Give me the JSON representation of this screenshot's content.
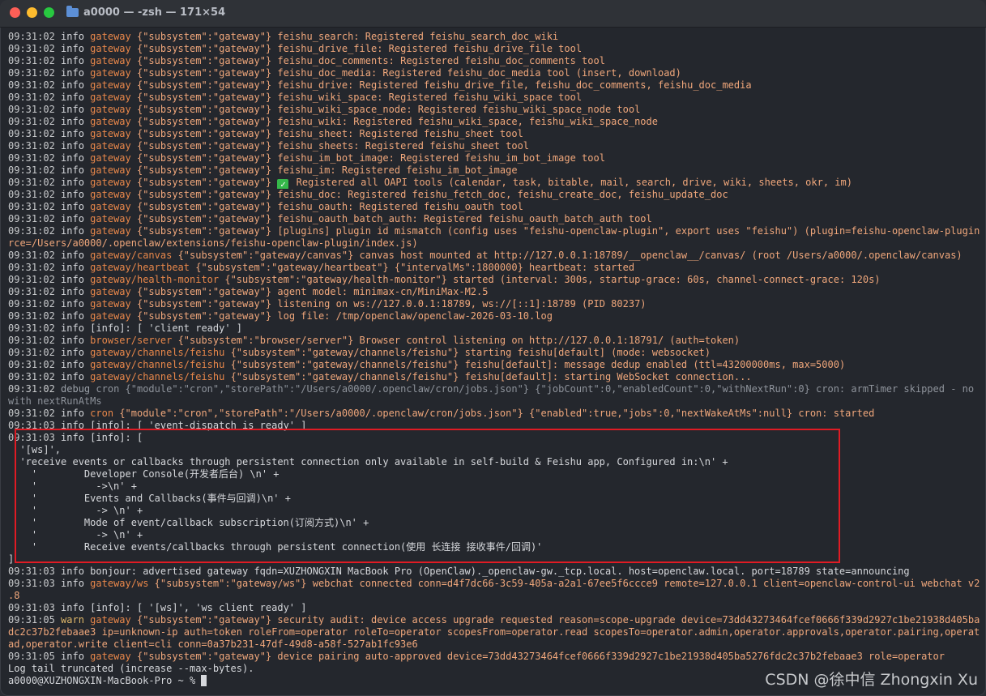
{
  "window": {
    "title": "a0000 — -zsh — 171×54"
  },
  "colors": {
    "background": "#24272d",
    "subsystem": "#e8874a",
    "message": "#f0a77b",
    "highlight": "#e01b24"
  },
  "log": [
    {
      "ts": "09:31:02",
      "level": "info",
      "sub": "gateway",
      "msg": "{\"subsystem\":\"gateway\"} feishu_search: Registered feishu_search_doc_wiki"
    },
    {
      "ts": "09:31:02",
      "level": "info",
      "sub": "gateway",
      "msg": "{\"subsystem\":\"gateway\"} feishu_drive_file: Registered feishu_drive_file tool"
    },
    {
      "ts": "09:31:02",
      "level": "info",
      "sub": "gateway",
      "msg": "{\"subsystem\":\"gateway\"} feishu_doc_comments: Registered feishu_doc_comments tool"
    },
    {
      "ts": "09:31:02",
      "level": "info",
      "sub": "gateway",
      "msg": "{\"subsystem\":\"gateway\"} feishu_doc_media: Registered feishu_doc_media tool (insert, download)"
    },
    {
      "ts": "09:31:02",
      "level": "info",
      "sub": "gateway",
      "msg": "{\"subsystem\":\"gateway\"} feishu_drive: Registered feishu_drive_file, feishu_doc_comments, feishu_doc_media"
    },
    {
      "ts": "09:31:02",
      "level": "info",
      "sub": "gateway",
      "msg": "{\"subsystem\":\"gateway\"} feishu_wiki_space: Registered feishu_wiki_space tool"
    },
    {
      "ts": "09:31:02",
      "level": "info",
      "sub": "gateway",
      "msg": "{\"subsystem\":\"gateway\"} feishu_wiki_space_node: Registered feishu_wiki_space_node tool"
    },
    {
      "ts": "09:31:02",
      "level": "info",
      "sub": "gateway",
      "msg": "{\"subsystem\":\"gateway\"} feishu_wiki: Registered feishu_wiki_space, feishu_wiki_space_node"
    },
    {
      "ts": "09:31:02",
      "level": "info",
      "sub": "gateway",
      "msg": "{\"subsystem\":\"gateway\"} feishu_sheet: Registered feishu_sheet tool"
    },
    {
      "ts": "09:31:02",
      "level": "info",
      "sub": "gateway",
      "msg": "{\"subsystem\":\"gateway\"} feishu_sheets: Registered feishu_sheet tool"
    },
    {
      "ts": "09:31:02",
      "level": "info",
      "sub": "gateway",
      "msg": "{\"subsystem\":\"gateway\"} feishu_im_bot_image: Registered feishu_im_bot_image tool"
    },
    {
      "ts": "09:31:02",
      "level": "info",
      "sub": "gateway",
      "msg": "{\"subsystem\":\"gateway\"} feishu_im: Registered feishu_im_bot_image"
    },
    {
      "ts": "09:31:02",
      "level": "info",
      "sub": "gateway",
      "check": "✓",
      "msg": "{\"subsystem\":\"gateway\"} ",
      "msg2": " Registered all OAPI tools (calendar, task, bitable, mail, search, drive, wiki, sheets, okr, im)"
    },
    {
      "ts": "09:31:02",
      "level": "info",
      "sub": "gateway",
      "msg": "{\"subsystem\":\"gateway\"} feishu_doc: Registered feishu_fetch_doc, feishu_create_doc, feishu_update_doc"
    },
    {
      "ts": "09:31:02",
      "level": "info",
      "sub": "gateway",
      "msg": "{\"subsystem\":\"gateway\"} feishu_oauth: Registered feishu_oauth tool"
    },
    {
      "ts": "09:31:02",
      "level": "info",
      "sub": "gateway",
      "msg": "{\"subsystem\":\"gateway\"} feishu_oauth_batch_auth: Registered feishu_oauth_batch_auth tool"
    },
    {
      "ts": "09:31:02",
      "level": "info",
      "sub": "gateway",
      "msg": "{\"subsystem\":\"gateway\"} [plugins] plugin id mismatch (config uses \"feishu-openclaw-plugin\", export uses \"feishu\") (plugin=feishu-openclaw-plugin, sou"
    },
    {
      "cont": "rce=/Users/a0000/.openclaw/extensions/feishu-openclaw-plugin/index.js)",
      "style": "msg"
    },
    {
      "ts": "09:31:02",
      "level": "info",
      "sub": "gateway/canvas",
      "msg": "{\"subsystem\":\"gateway/canvas\"} canvas host mounted at http://127.0.0.1:18789/__openclaw__/canvas/ (root /Users/a0000/.openclaw/canvas)"
    },
    {
      "ts": "09:31:02",
      "level": "info",
      "sub": "gateway/heartbeat",
      "msg": "{\"subsystem\":\"gateway/heartbeat\"} {\"intervalMs\":1800000} heartbeat: started"
    },
    {
      "ts": "09:31:02",
      "level": "info",
      "sub": "gateway/health-monitor",
      "msg": "{\"subsystem\":\"gateway/health-monitor\"} started (interval: 300s, startup-grace: 60s, channel-connect-grace: 120s)"
    },
    {
      "ts": "09:31:02",
      "level": "info",
      "sub": "gateway",
      "msg": "{\"subsystem\":\"gateway\"} agent model: minimax-cn/MiniMax-M2.5"
    },
    {
      "ts": "09:31:02",
      "level": "info",
      "sub": "gateway",
      "msg": "{\"subsystem\":\"gateway\"} listening on ws://127.0.0.1:18789, ws://[::1]:18789 (PID 80237)"
    },
    {
      "ts": "09:31:02",
      "level": "info",
      "sub": "gateway",
      "msg": "{\"subsystem\":\"gateway\"} log file: /tmp/openclaw/openclaw-2026-03-10.log"
    },
    {
      "ts": "09:31:02",
      "level": "info",
      "sub": "",
      "msg": "[info]: [ 'client ready' ]",
      "style": "plain"
    },
    {
      "ts": "09:31:02",
      "level": "info",
      "sub": "browser/server",
      "msg": "{\"subsystem\":\"browser/server\"} Browser control listening on http://127.0.0.1:18791/ (auth=token)"
    },
    {
      "ts": "09:31:02",
      "level": "info",
      "sub": "gateway/channels/feishu",
      "msg": "{\"subsystem\":\"gateway/channels/feishu\"} starting feishu[default] (mode: websocket)"
    },
    {
      "ts": "09:31:02",
      "level": "info",
      "sub": "gateway/channels/feishu",
      "msg": "{\"subsystem\":\"gateway/channels/feishu\"} feishu[default]: message dedup enabled (ttl=43200000ms, max=5000)"
    },
    {
      "ts": "09:31:02",
      "level": "info",
      "sub": "gateway/channels/feishu",
      "msg": "{\"subsystem\":\"gateway/channels/feishu\"} feishu[default]: starting WebSocket connection..."
    },
    {
      "ts": "09:31:02",
      "level": "debug",
      "sub": "cron",
      "msg": "{\"module\":\"cron\",\"storePath\":\"/Users/a0000/.openclaw/cron/jobs.json\"} {\"jobCount\":0,\"enabledCount\":0,\"withNextRun\":0} cron: armTimer skipped - no jobs",
      "style": "dim"
    },
    {
      "cont": "with nextRunAtMs",
      "style": "dim"
    },
    {
      "ts": "09:31:02",
      "level": "info",
      "sub": "cron",
      "msg": "{\"module\":\"cron\",\"storePath\":\"/Users/a0000/.openclaw/cron/jobs.json\"} {\"enabled\":true,\"jobs\":0,\"nextWakeAtMs\":null} cron: started"
    },
    {
      "ts": "09:31:03",
      "level": "info",
      "sub": "",
      "msg": "[info]: [ 'event-dispatch is ready' ]",
      "style": "plain"
    },
    {
      "ts": "09:31:03",
      "level": "info",
      "sub": "",
      "msg": "[info]: [",
      "style": "plain"
    },
    {
      "cont": "  '[ws]',",
      "style": "plain"
    },
    {
      "cont": "  'receive events or callbacks through persistent connection only available in self-build & Feishu app, Configured in:\\n' +",
      "style": "plain"
    },
    {
      "cont": "    '        Developer Console(开发者后台) \\n' +",
      "style": "plain"
    },
    {
      "cont": "    '          ->\\n' +",
      "style": "plain"
    },
    {
      "cont": "    '        Events and Callbacks(事件与回调)\\n' +",
      "style": "plain"
    },
    {
      "cont": "    '          -> \\n' +",
      "style": "plain"
    },
    {
      "cont": "    '        Mode of event/callback subscription(订阅方式)\\n' +",
      "style": "plain"
    },
    {
      "cont": "    '          -> \\n' +",
      "style": "plain"
    },
    {
      "cont": "    '        Receive events/callbacks through persistent connection(使用 长连接 接收事件/回调)'",
      "style": "plain"
    },
    {
      "cont": "]",
      "style": "plain"
    },
    {
      "ts": "09:31:03",
      "level": "info",
      "sub": "",
      "msg": "bonjour: advertised gateway fqdn=XUZHONGXIN MacBook Pro (OpenClaw)._openclaw-gw._tcp.local. host=openclaw.local. port=18789 state=announcing",
      "style": "plain"
    },
    {
      "ts": "09:31:03",
      "level": "info",
      "sub": "gateway/ws",
      "msg": "{\"subsystem\":\"gateway/ws\"} webchat connected conn=d4f7dc66-3c59-405a-a2a1-67ee5f6ccce9 remote=127.0.0.1 client=openclaw-control-ui webchat v2026.3"
    },
    {
      "cont": ".8",
      "style": "msg"
    },
    {
      "ts": "09:31:03",
      "level": "info",
      "sub": "",
      "msg": "[info]: [ '[ws]', 'ws client ready' ]",
      "style": "plain"
    },
    {
      "ts": "09:31:05",
      "level": "warn",
      "sub": "gateway",
      "msg": "{\"subsystem\":\"gateway\"} security audit: device access upgrade requested reason=scope-upgrade device=73dd43273464fcef0666f339d2927c1be21938d405ba5276f"
    },
    {
      "cont": "dc2c37b2febaae3 ip=unknown-ip auth=token roleFrom=operator roleTo=operator scopesFrom=operator.read scopesTo=operator.admin,operator.approvals,operator.pairing,operator.re",
      "style": "msg"
    },
    {
      "cont": "ad,operator.write client=cli conn=0a37b231-47df-49d8-a58f-527ab1fc93e6",
      "style": "msg"
    },
    {
      "ts": "09:31:05",
      "level": "info",
      "sub": "gateway",
      "msg": "{\"subsystem\":\"gateway\"} device pairing auto-approved device=73dd43273464fcef0666f339d2927c1be21938d405ba5276fdc2c37b2febaae3 role=operator"
    },
    {
      "cont": "Log tail truncated (increase --max-bytes).",
      "style": "plain"
    }
  ],
  "prompt": "a0000@XUZHONGXIN-MacBook-Pro ~ % ",
  "watermark": "CSDN @徐中信 Zhongxin Xu"
}
